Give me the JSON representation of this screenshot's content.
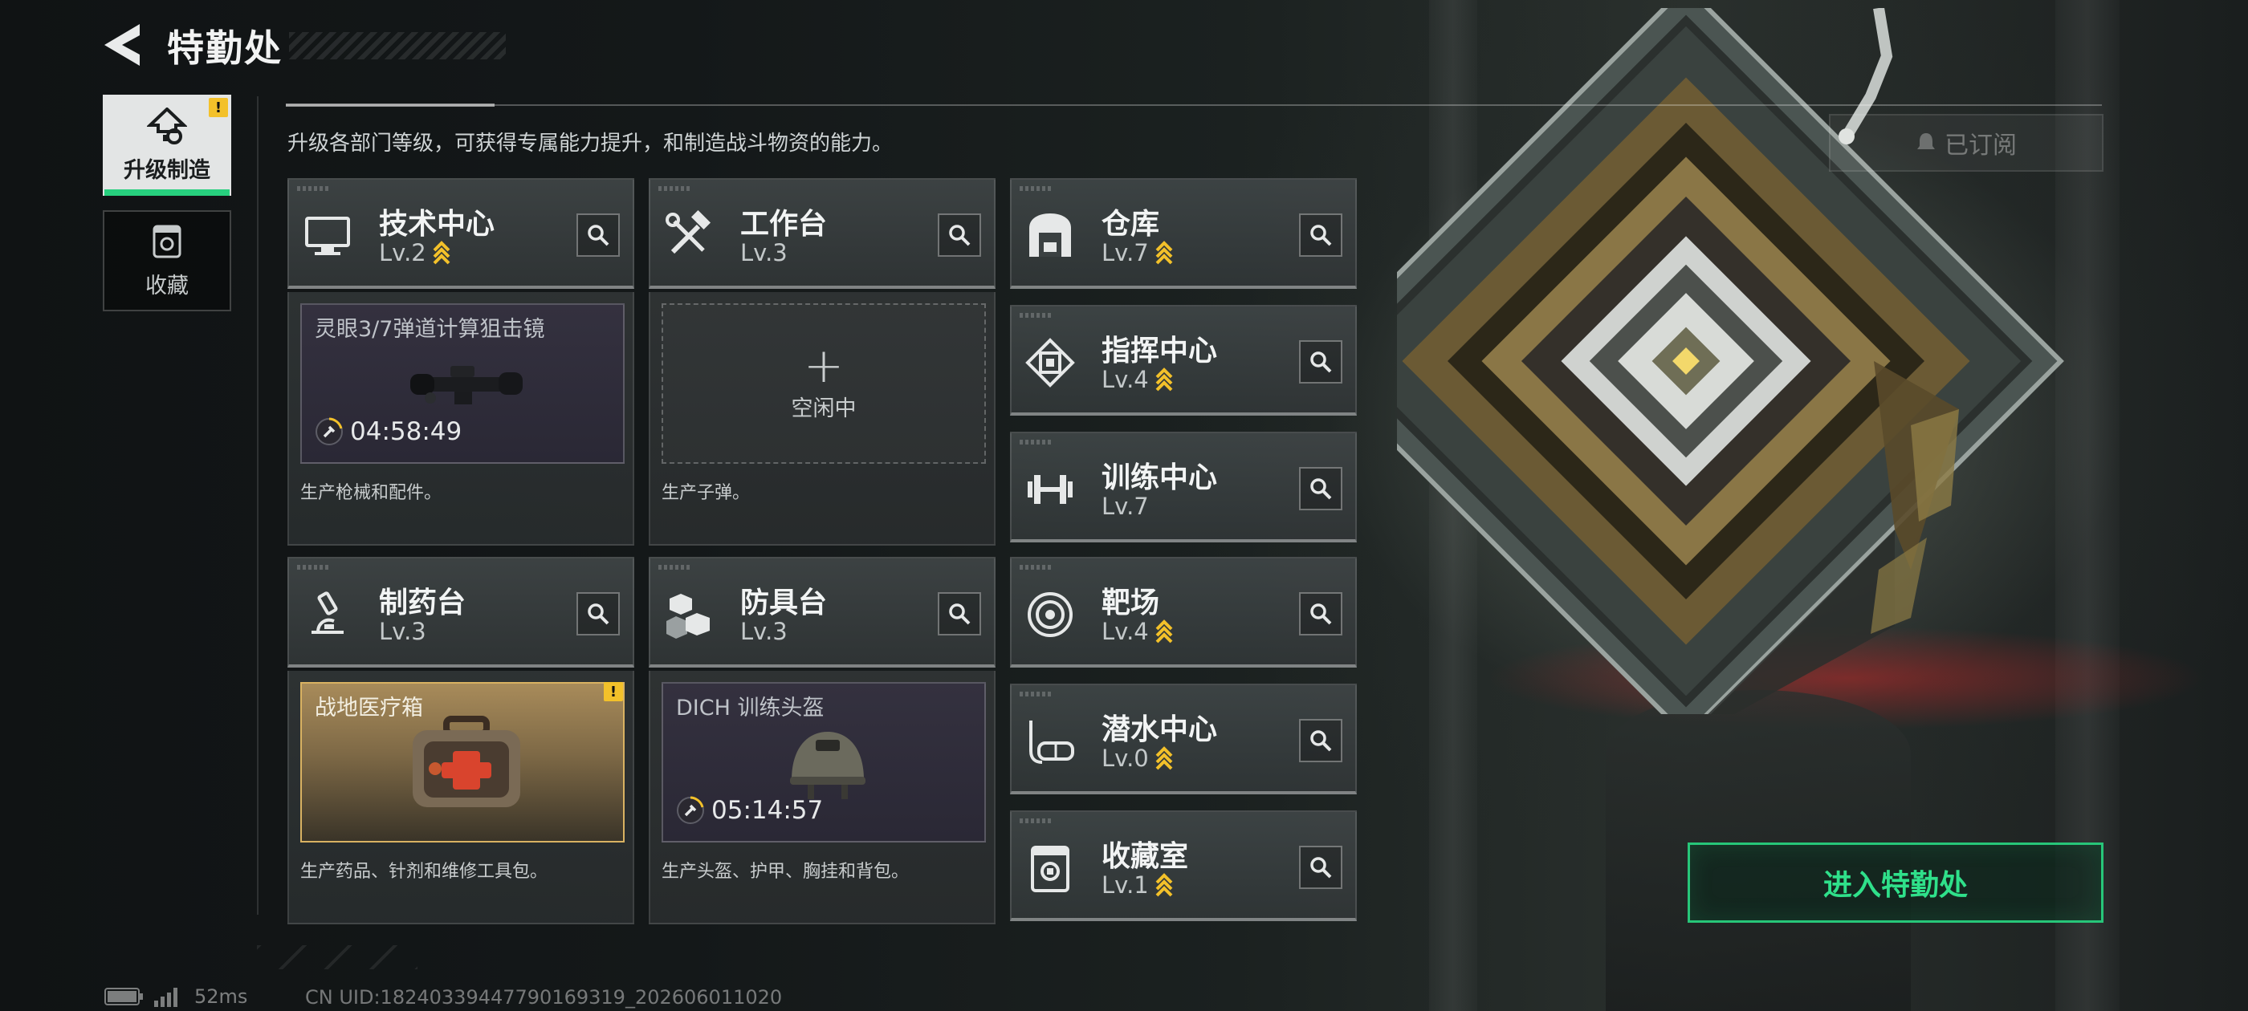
{
  "header": {
    "title": "特勤处",
    "description": "升级各部门等级，可获得专属能力提升，和制造战斗物资的能力。",
    "subscribed_label": "已订阅"
  },
  "nav": {
    "items": [
      {
        "label": "升级制造",
        "active": true,
        "badge": "!"
      },
      {
        "label": "收藏",
        "active": false
      }
    ]
  },
  "facilities": {
    "tech_center": {
      "name": "技术中心",
      "level": "Lv.2",
      "upgradable": true,
      "slot": {
        "item": "灵眼3/7弹道计算狙击镜",
        "timer": "04:58:49"
      },
      "description": "生产枪械和配件。"
    },
    "workbench": {
      "name": "工作台",
      "level": "Lv.3",
      "upgradable": false,
      "slot": {
        "status": "空闲中"
      },
      "description": "生产子弹。"
    },
    "warehouse": {
      "name": "仓库",
      "level": "Lv.7",
      "upgradable": true
    },
    "command_center": {
      "name": "指挥中心",
      "level": "Lv.4",
      "upgradable": true
    },
    "training_center": {
      "name": "训练中心",
      "level": "Lv.7",
      "upgradable": false
    },
    "pharmacy": {
      "name": "制药台",
      "level": "Lv.3",
      "upgradable": false,
      "slot": {
        "item": "战地医疗箱",
        "badge": "!"
      },
      "description": "生产药品、针剂和维修工具包。"
    },
    "armor_bench": {
      "name": "防具台",
      "level": "Lv.3",
      "upgradable": false,
      "slot": {
        "item": "DICH 训练头盔",
        "timer": "05:14:57"
      },
      "description": "生产头盔、护甲、胸挂和背包。"
    },
    "shooting_range": {
      "name": "靶场",
      "level": "Lv.4",
      "upgradable": true
    },
    "diving_center": {
      "name": "潜水中心",
      "level": "Lv.0",
      "upgradable": true
    },
    "collection_room": {
      "name": "收藏室",
      "level": "Lv.1",
      "upgradable": true
    }
  },
  "enter_button": "进入特勤处",
  "status": {
    "ping": "52ms",
    "uid": "CN UID:18240339447790169319_202606011020"
  },
  "colors": {
    "accent_green": "#27c679",
    "upgrade_gold": "#f3c12a",
    "ready_gold": "#d9b262"
  }
}
